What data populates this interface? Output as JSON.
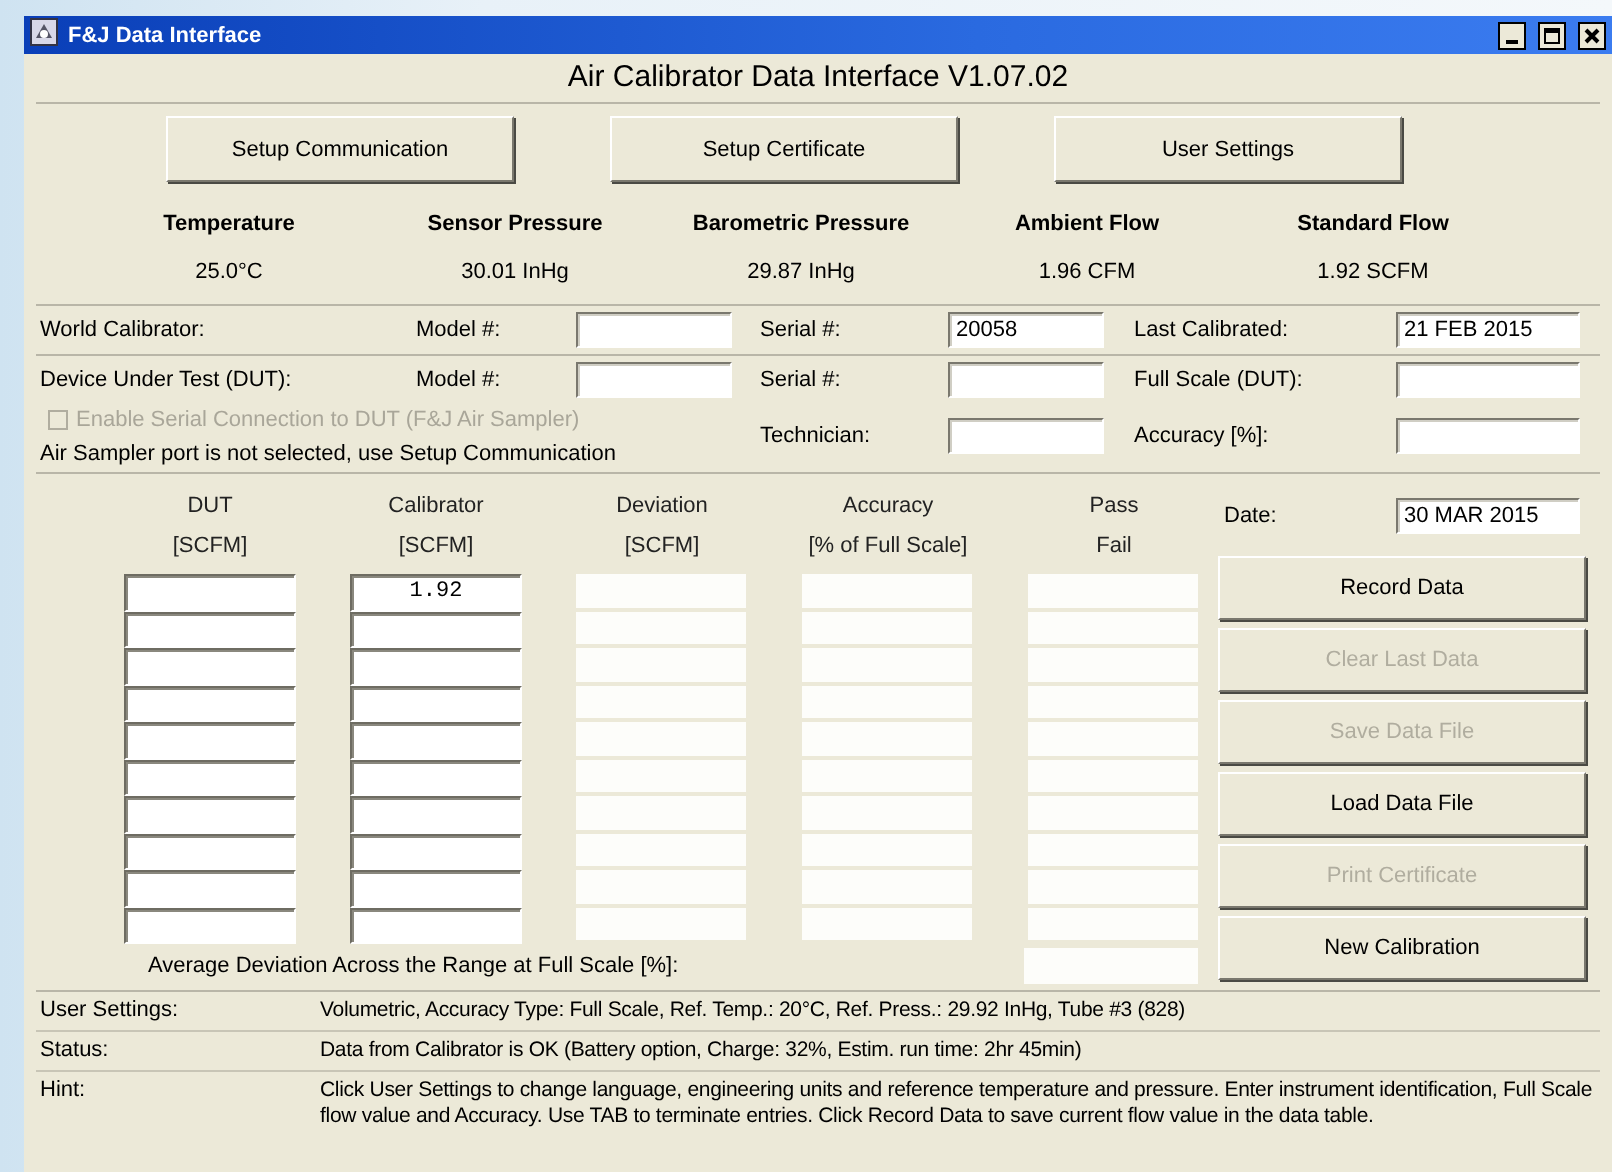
{
  "window": {
    "title": "F&J Data Interface"
  },
  "app_title": "Air Calibrator Data Interface  V1.07.02",
  "top_buttons": [
    {
      "label": "Setup Communication"
    },
    {
      "label": "Setup Certificate"
    },
    {
      "label": "User Settings"
    }
  ],
  "readings": [
    {
      "label": "Temperature",
      "value": "25.0°C"
    },
    {
      "label": "Sensor Pressure",
      "value": "30.01  InHg"
    },
    {
      "label": "Barometric Pressure",
      "value": "29.87  InHg"
    },
    {
      "label": "Ambient Flow",
      "value": "1.96  CFM"
    },
    {
      "label": "Standard Flow",
      "value": "1.92  SCFM"
    }
  ],
  "world_calibrator": {
    "label": "World Calibrator:",
    "fields": [
      {
        "label": "Model #:"
      },
      {
        "label": "Serial #:",
        "value": "20058"
      },
      {
        "label": "Last Calibrated:",
        "value": "21 FEB 2015"
      }
    ]
  },
  "dut": {
    "label": "Device Under Test (DUT):",
    "fields": [
      {
        "label": "Model #:"
      },
      {
        "label": "Serial #:"
      },
      {
        "label": "Full Scale (DUT):"
      },
      {
        "label": "Technician:"
      },
      {
        "label": "Accuracy [%]:"
      }
    ],
    "serial_checkbox": {
      "label": "Enable Serial Connection to DUT (F&J Air Sampler)",
      "checked": false,
      "disabled": true
    },
    "port_note": "Air Sampler port is not selected, use Setup Communication"
  },
  "table": {
    "columns": [
      {
        "heading": "DUT",
        "unit": "[SCFM]",
        "kind": "input"
      },
      {
        "heading": "Calibrator",
        "unit": "[SCFM]",
        "kind": "input"
      },
      {
        "heading": "Deviation",
        "unit": "[SCFM]",
        "kind": "readonly"
      },
      {
        "heading": "Accuracy",
        "unit": "[% of Full Scale]",
        "kind": "readonly"
      },
      {
        "heading": "Pass",
        "unit": "Fail",
        "kind": "readonly"
      }
    ],
    "rows": [
      {
        "cells": [
          null,
          "1.92",
          null,
          null,
          null
        ]
      },
      {
        "cells": [
          null,
          null,
          null,
          null,
          null
        ]
      },
      {
        "cells": [
          null,
          null,
          null,
          null,
          null
        ]
      },
      {
        "cells": [
          null,
          null,
          null,
          null,
          null
        ]
      },
      {
        "cells": [
          null,
          null,
          null,
          null,
          null
        ]
      },
      {
        "cells": [
          null,
          null,
          null,
          null,
          null
        ]
      },
      {
        "cells": [
          null,
          null,
          null,
          null,
          null
        ]
      },
      {
        "cells": [
          null,
          null,
          null,
          null,
          null
        ]
      },
      {
        "cells": [
          null,
          null,
          null,
          null,
          null
        ]
      },
      {
        "cells": [
          null,
          null,
          null,
          null,
          null
        ]
      }
    ],
    "average_label": "Average Deviation Across the Range at Full Scale [%]:"
  },
  "date": {
    "label": "Date:",
    "value": "30 MAR 2015"
  },
  "actions": [
    {
      "label": "Record Data",
      "disabled": false
    },
    {
      "label": "Clear Last Data",
      "disabled": true
    },
    {
      "label": "Save Data File",
      "disabled": true
    },
    {
      "label": "Load Data File",
      "disabled": false
    },
    {
      "label": "Print Certificate",
      "disabled": true
    },
    {
      "label": "New Calibration",
      "disabled": false
    }
  ],
  "info": [
    {
      "label": "User Settings:",
      "text": "Volumetric, Accuracy Type: Full Scale, Ref. Temp.: 20°C, Ref. Press.: 29.92 InHg, Tube #3 (828)"
    },
    {
      "label": "Status:",
      "text": "Data from Calibrator is OK (Battery option, Charge: 32%, Estim. run time: 2hr 45min)"
    },
    {
      "label": "Hint:",
      "text": "Click User Settings to change language, engineering units and reference temperature and pressure. Enter instrument identification, Full Scale flow value and Accuracy. Use TAB to terminate entries. Click Record Data to save current flow value in the data table."
    }
  ]
}
